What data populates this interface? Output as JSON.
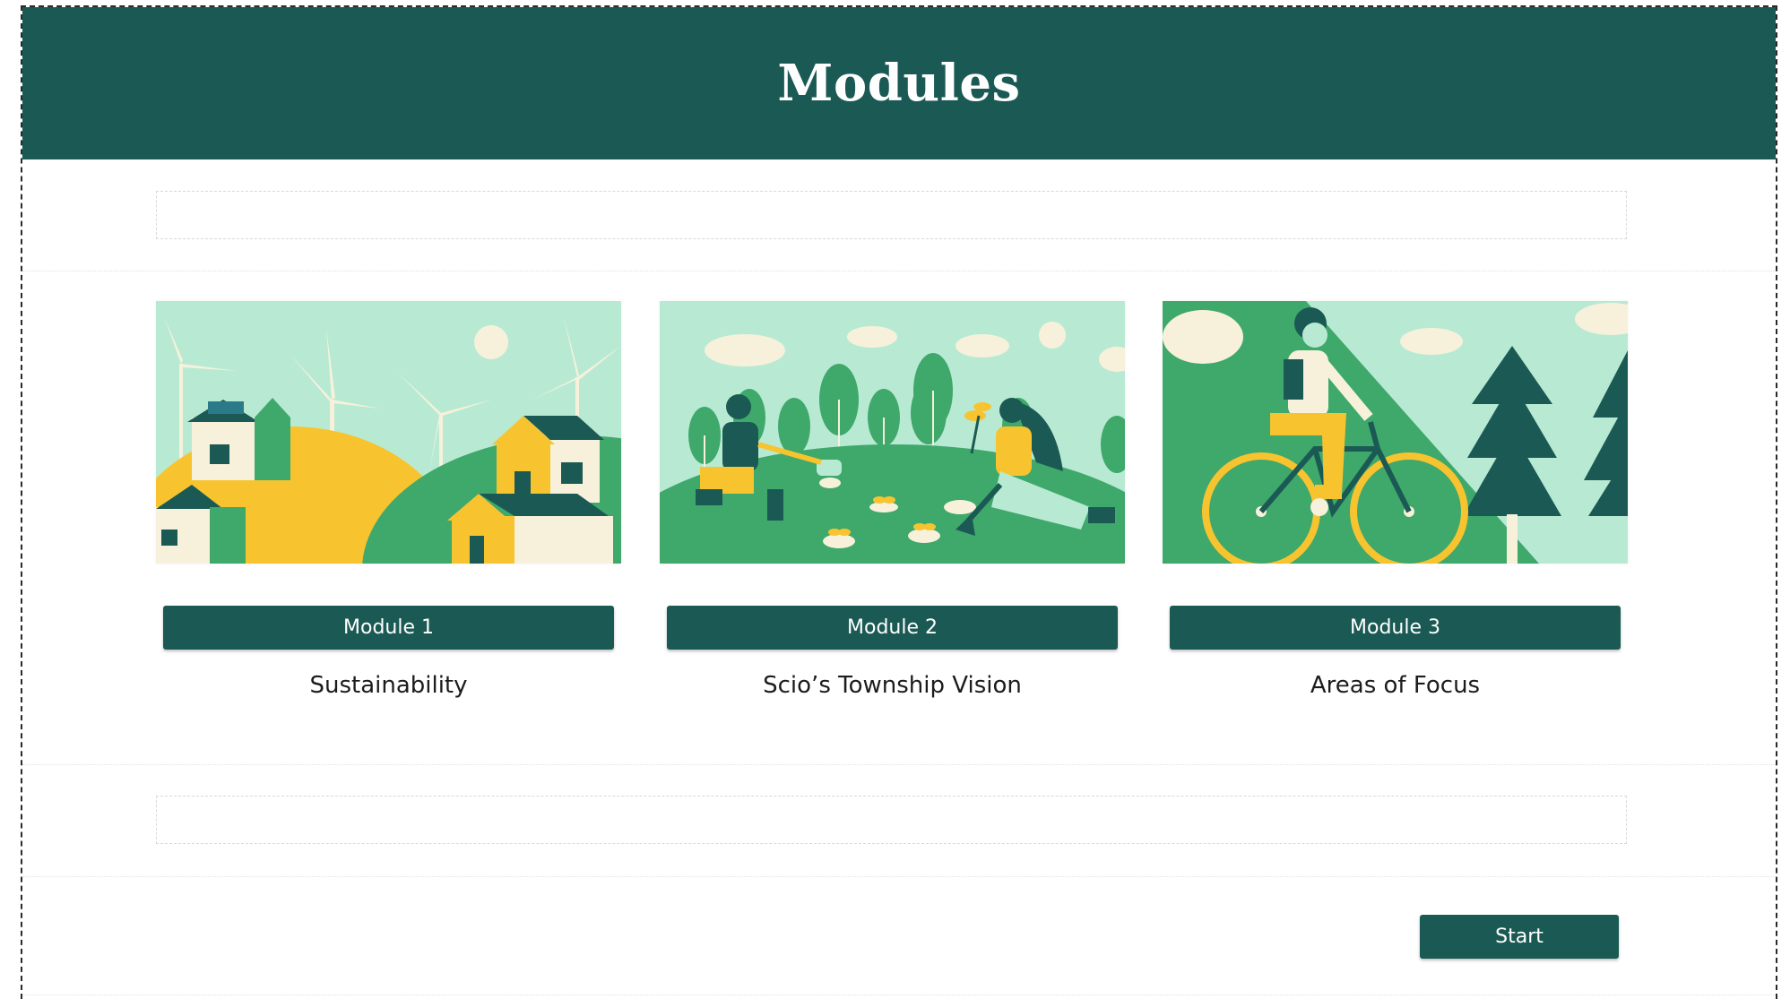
{
  "header": {
    "title": "Modules"
  },
  "modules": [
    {
      "button_label": "Module 1",
      "title": "Sustainability",
      "image": "sustainable-houses-wind-turbines-illustration"
    },
    {
      "button_label": "Module 2",
      "title": "Scio’s Township Vision",
      "image": "people-planting-seedlings-illustration"
    },
    {
      "button_label": "Module 3",
      "title": "Areas of Focus",
      "image": "cyclist-in-forest-illustration"
    }
  ],
  "footer": {
    "start_label": "Start"
  },
  "colors": {
    "primary": "#1b5a54",
    "mint": "#b8ead3",
    "green": "#3fa86b",
    "yellow": "#f7c430",
    "cream": "#f7f1dc"
  }
}
